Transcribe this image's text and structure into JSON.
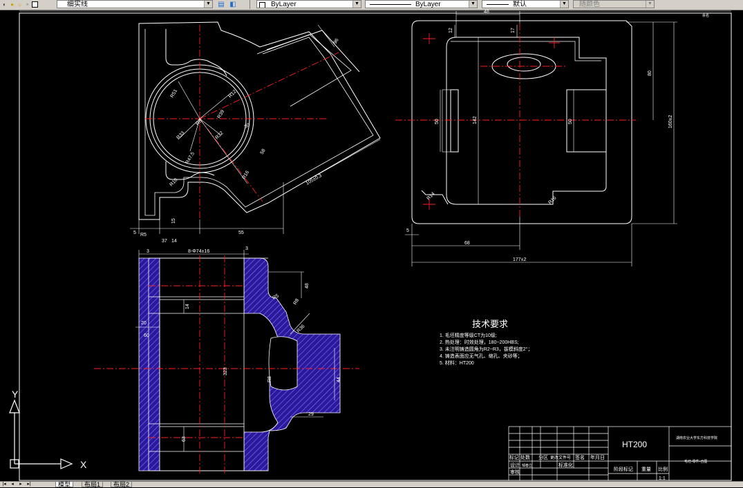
{
  "toolbar": {
    "layer_name": "细实线",
    "color_value": "ByLayer",
    "linetype_value": "ByLayer",
    "lineweight_value": "默认",
    "plotstyle_value": "随颜色"
  },
  "ucs": {
    "x_label": "X",
    "y_label": "Y"
  },
  "tabs": {
    "model": "模型",
    "layout1": "布局1",
    "layout2": "布局2"
  },
  "dims": {
    "top_left": [
      "R51",
      "R33",
      "R8",
      "R32",
      "R47.5",
      "R39",
      "R16",
      "R10",
      "R5",
      "R12",
      "5",
      "37",
      "14",
      "55",
      "30",
      "58",
      "15",
      "105±0.3",
      "96"
    ],
    "top_right": [
      "48",
      "12",
      "17",
      "80",
      "50",
      "142",
      "50",
      "R14",
      "R16",
      "160±2",
      "5",
      "68",
      "177±2",
      "余名"
    ],
    "bottom_left": [
      "3",
      "3",
      "8-Φ74±16",
      "48",
      "R5",
      "14",
      "R8",
      "60",
      "20",
      "R36",
      "323",
      "44",
      "R8",
      "29",
      "63"
    ]
  },
  "tech_req": {
    "title": "技术要求",
    "items": [
      "1.    毛坯精度等级CT为10级;",
      "2.    热处理：时效处理，180~200HBS;",
      "3.    未注明铸造圆角为R2~R3，拔模斜度2°；",
      "4.    铸造表面应无气孔、缩孔、夹砂等；",
      "5.    材料：HT200"
    ]
  },
  "title_block": {
    "material": "HT200",
    "school": "湖南农业大学东方科技学院",
    "drawing_name": "毛坯-零件-合图",
    "col_headers": [
      "标记",
      "处数",
      "分区",
      "更改文件号",
      "签名",
      "年月日"
    ],
    "row_design": "设计",
    "designer": "邹春立",
    "standardize": "标准化",
    "row_review": "审核",
    "stage_mark": "阶段标记",
    "weight": "重量",
    "scale": "比例",
    "scale_value": "1:1"
  },
  "colors": {
    "background": "#000000",
    "line": "#ffffff",
    "center": "#ff0000",
    "hatch": "#5a3fd6",
    "hatch_bg": "#2a1a9a"
  }
}
